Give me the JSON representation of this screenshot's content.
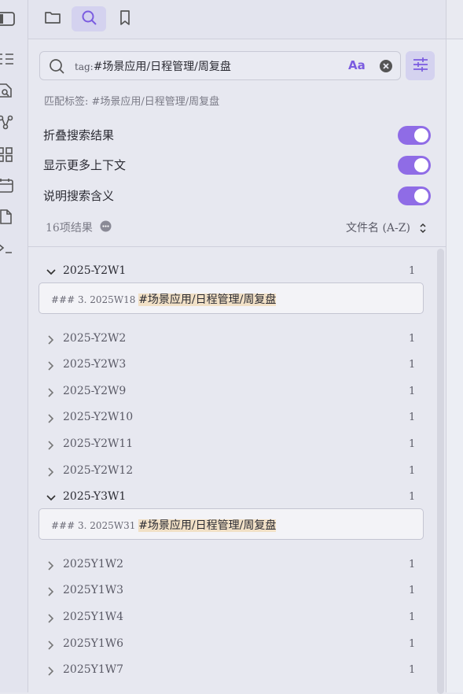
{
  "ribbon": {
    "icons": [
      "sidebar-toggle-icon",
      "list-icon",
      "page-search-icon",
      "graph-icon",
      "blocks-icon",
      "calendar-icon",
      "file-copy-icon",
      "terminal-icon"
    ]
  },
  "tabs": [
    {
      "name": "files",
      "icon": "folder-icon",
      "active": false
    },
    {
      "name": "search",
      "icon": "search-icon",
      "active": true
    },
    {
      "name": "bookmarks",
      "icon": "bookmark-icon",
      "active": false
    }
  ],
  "search": {
    "query_prefix": "tag:",
    "query_tag": "#场景应用/日程管理/周复盘",
    "match_case_label": "Aa",
    "match_info": "匹配标签: #场景应用/日程管理/周复盘"
  },
  "options": [
    {
      "label": "折叠搜索结果",
      "on": true
    },
    {
      "label": "显示更多上下文",
      "on": true
    },
    {
      "label": "说明搜索含义",
      "on": true
    }
  ],
  "results": {
    "count_label": "16项结果",
    "sort_label": "文件名 (A-Z)",
    "files": [
      {
        "name": "2025-Y2W1",
        "count": "1",
        "open": true,
        "match_prefix": "### 3. 2025W18 ",
        "match_hl": "#场景应用/日程管理/周复盘"
      },
      {
        "name": "2025-Y2W2",
        "count": "1",
        "open": false
      },
      {
        "name": "2025-Y2W3",
        "count": "1",
        "open": false
      },
      {
        "name": "2025-Y2W9",
        "count": "1",
        "open": false
      },
      {
        "name": "2025-Y2W10",
        "count": "1",
        "open": false
      },
      {
        "name": "2025-Y2W11",
        "count": "1",
        "open": false
      },
      {
        "name": "2025-Y2W12",
        "count": "1",
        "open": false
      },
      {
        "name": "2025-Y3W1",
        "count": "1",
        "open": true,
        "match_prefix": "### 3. 2025W31 ",
        "match_hl": "#场景应用/日程管理/周复盘"
      },
      {
        "name": "2025Y1W2",
        "count": "1",
        "open": false
      },
      {
        "name": "2025Y1W3",
        "count": "1",
        "open": false
      },
      {
        "name": "2025Y1W4",
        "count": "1",
        "open": false
      },
      {
        "name": "2025Y1W6",
        "count": "1",
        "open": false
      },
      {
        "name": "2025Y1W7",
        "count": "1",
        "open": false
      }
    ]
  },
  "colors": {
    "accent": "#8f6ce6",
    "highlight": "#f1e0c6",
    "active_tab": "#d4d2ef"
  }
}
